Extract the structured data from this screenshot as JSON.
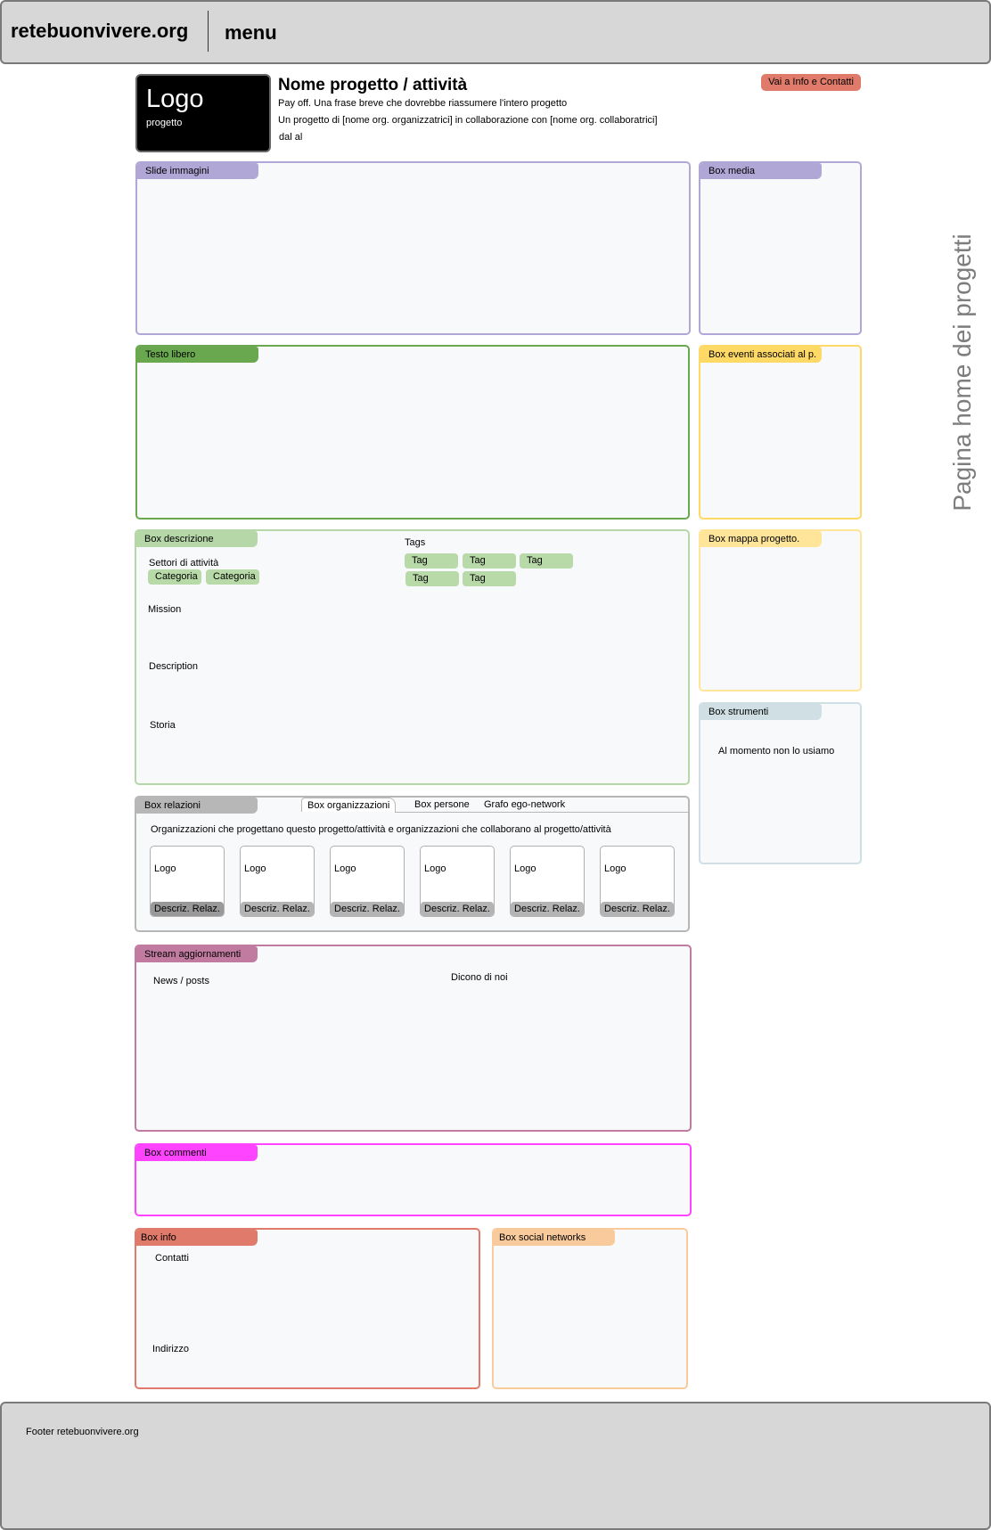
{
  "header": {
    "site_name": "retebuonvivere.org",
    "menu_label": "menu"
  },
  "project": {
    "logo_title": "Logo",
    "logo_subtitle": "progetto",
    "title": "Nome progetto / attività",
    "payoff": "Pay off. Una frase breve che dovrebbe riassumere l'intero progetto",
    "partners": "Un progetto di [nome org. organizzatrici] in collaborazione con [nome org. collaboratrici]",
    "dates": "dal al",
    "contact_button": "Vai a Info e Contatti"
  },
  "boxes": {
    "slides": "Slide immagini",
    "media": "Box media",
    "free_text": "Testo libero",
    "events": "Box eventi associati al p.",
    "description": "Box descrizione",
    "map": "Box mappa progetto.",
    "tools": "Box strumenti",
    "relations": "Box relazioni",
    "stream": "Stream aggiornamenti",
    "comments": "Box commenti",
    "info": "Box info",
    "social": "Box social networks"
  },
  "description": {
    "sectors_label": "Settori di attività",
    "categories": [
      "Categoria",
      "Categoria"
    ],
    "tags_label": "Tags",
    "tags": [
      "Tag",
      "Tag",
      "Tag",
      "Tag",
      "Tag"
    ],
    "mission": "Mission",
    "description": "Description",
    "history": "Storia"
  },
  "tools": {
    "note": "Al momento non lo usiamo"
  },
  "relations": {
    "tabs": [
      "Box organizzazioni",
      "Box persone",
      "Grafo ego-network"
    ],
    "active_tab": 0,
    "intro": "Organizzazioni che progettano questo progetto/attività e organizzazioni che collaborano al progetto/attività",
    "cards": [
      {
        "logo": "Logo",
        "relation": "Descriz. Relaz."
      },
      {
        "logo": "Logo",
        "relation": "Descriz. Relaz."
      },
      {
        "logo": "Logo",
        "relation": "Descriz. Relaz."
      },
      {
        "logo": "Logo",
        "relation": "Descriz. Relaz."
      },
      {
        "logo": "Logo",
        "relation": "Descriz. Relaz."
      },
      {
        "logo": "Logo",
        "relation": "Descriz. Relaz."
      }
    ]
  },
  "stream": {
    "news": "News / posts",
    "mentions": "Dicono di noi"
  },
  "info": {
    "contacts": "Contatti",
    "address": "Indirizzo"
  },
  "side_label": "Pagina home dei progetti",
  "footer": {
    "text": "Footer retebuonvivere.org"
  },
  "colors": {
    "lavender": "#b1a7d6",
    "green_dark": "#6aa84f",
    "green_light": "#b6d7a8",
    "yellow": "#ffd966",
    "yellow_light": "#ffe599",
    "blue_grey": "#cfdfe3",
    "grey": "#b7b7b7",
    "mauve": "#c27ba0",
    "magenta": "#ff44ff",
    "salmon": "#e07b6b",
    "peach": "#f9cb9c"
  }
}
